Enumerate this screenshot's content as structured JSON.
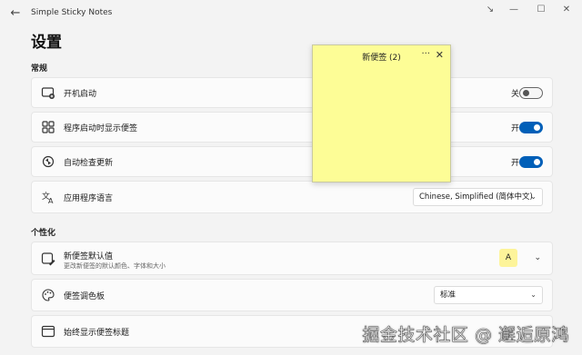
{
  "app": {
    "title": "Simple Sticky Notes"
  },
  "page_title": "设置",
  "sections": {
    "general": "常规",
    "personalize": "个性化"
  },
  "settings": {
    "startup": {
      "label": "开机启动",
      "state": "关"
    },
    "show_on_start": {
      "label": "程序启动时显示便签",
      "state": "开"
    },
    "auto_update": {
      "label": "自动检查更新",
      "state": "开"
    },
    "language": {
      "label": "应用程序语言",
      "value": "Chinese, Simplified (简体中文)"
    },
    "note_defaults": {
      "label": "新便签默认值",
      "sub": "更改新便签的默认颜色、字体和大小",
      "swatch_letter": "A"
    },
    "palette": {
      "label": "便签调色板",
      "value": "标准"
    },
    "always_title": {
      "label": "始终显示便签标题"
    }
  },
  "note": {
    "title": "新便签 (2)",
    "bg_color": "#fdfd96"
  },
  "colors": {
    "accent": "#005fb8"
  },
  "watermark": "掘金技术社区 @ 邂逅原鸿"
}
